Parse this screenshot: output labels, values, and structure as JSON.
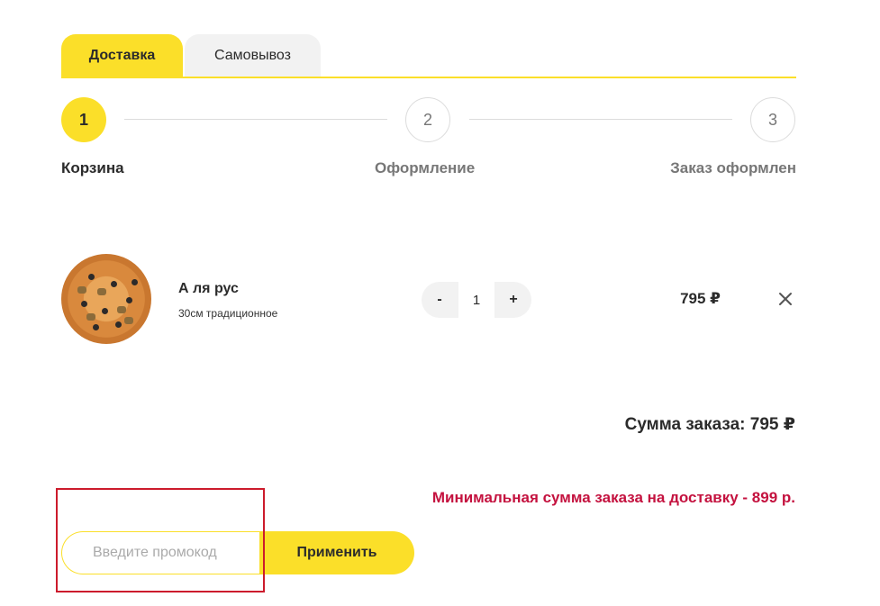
{
  "tabs": [
    {
      "label": "Доставка"
    },
    {
      "label": "Самовывоз"
    }
  ],
  "steps": [
    {
      "number": "1",
      "label": "Корзина"
    },
    {
      "number": "2",
      "label": "Оформление"
    },
    {
      "number": "3",
      "label": "Заказ оформлен"
    }
  ],
  "cart_item": {
    "name": "А ля рус",
    "description": "30см традиционное",
    "quantity": "1",
    "minus_label": "-",
    "plus_label": "+",
    "price": "795 ₽",
    "image_icon": "pizza-image",
    "remove_icon": "close-icon"
  },
  "summary": {
    "total_label": "Сумма заказа: ",
    "total_value": "795 ₽",
    "min_order_notice": "Минимальная сумма заказа на доставку - 899 р."
  },
  "promo": {
    "placeholder": "Введите промокод",
    "value": "",
    "apply_label": "Применить"
  },
  "colors": {
    "accent": "#fbdf29",
    "warning": "#c4123f",
    "highlight_border": "#cc1b2c"
  }
}
